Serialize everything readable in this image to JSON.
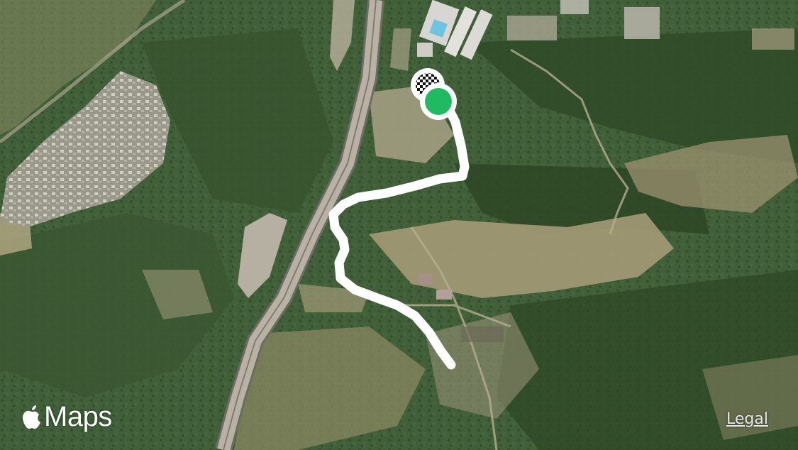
{
  "map": {
    "view": "satellite",
    "route": {
      "color": "#ffffff",
      "start_marker_icon": "green-dot-start-icon",
      "finish_marker_icon": "checkered-flag-finish-icon",
      "start_color": "#1fba62"
    }
  },
  "branding": {
    "logo_icon": "apple-logo-icon",
    "label": "Maps"
  },
  "legal_link": {
    "label": "Legal"
  },
  "colors": {
    "vegetation_dark": "#3c5630",
    "vegetation_light": "#5f7a47",
    "grassland": "#a59a78",
    "highway": "#b9b2a4"
  }
}
